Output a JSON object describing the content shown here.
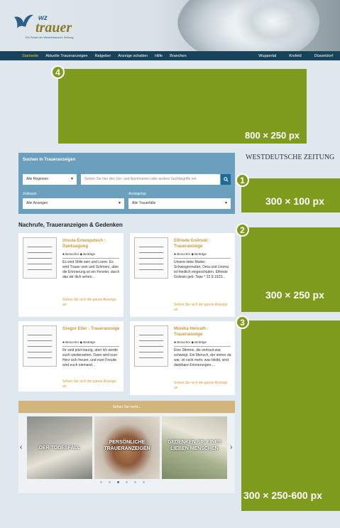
{
  "header": {
    "logo_wz": "wz",
    "logo_main": "trauer",
    "logo_tag": "Ein Portal der Westdeutschen Zeitung"
  },
  "nav": {
    "items": [
      "Startseite",
      "Aktuelle Traueranzeigen",
      "Ratgeber",
      "Anzeige schalten",
      "Hilfe",
      "Branchen"
    ],
    "right_items": [
      "Wuppertal",
      "Krefeld",
      "Düsseldorf"
    ]
  },
  "ads": {
    "leaderboard": {
      "badge": "4",
      "label": "800 × 250 px"
    },
    "ad1": {
      "badge": "1",
      "label": "300 × 100 px"
    },
    "ad2": {
      "badge": "2",
      "label": "300 × 250 px"
    },
    "ad3": {
      "badge": "3",
      "label": "300 × 250-600 px"
    }
  },
  "partner_logo": "Westdeutsche Zeitung",
  "search": {
    "title": "Suchen in Traueranzeigen",
    "region": "Alle Regionen",
    "query_placeholder": "Geben Sie hier den Vor- und Nachnamen oder andere Suchbegriffe ein",
    "timeframe_label": "Zeitraum",
    "timeframe_value": "Alle Anzeigen",
    "type_label": "Anzeigetyp",
    "type_value": "Alle Trauerfälle"
  },
  "section_title": "Nachrufe, Traueranzeigen & Gedenken",
  "cards": [
    {
      "name": "Ursula Ernenputsch : Danksagung",
      "visitors": "Besucher",
      "posts": "Beiträge",
      "text": "Es wird Stille sein und Leere. Es wird Trauer sein und Schmerz, aber die Erinnerung ist ein Fenster, durch das wir dich sehen...",
      "more": "Sehen Sie sich die ganze Anzeige an"
    },
    {
      "name": "Elfriede Golinski : Traueranzeige",
      "visitors": "Besucher",
      "posts": "Beiträge",
      "text": "Unsere liebe Mutter, Schwiegermutter, Oma und Uroma ist friedlich eingeschlafen. Elfriede Golinski geb. Tepe * 22.9.1923...",
      "more": "Sehen Sie sich die ganze Anzeige an"
    },
    {
      "name": "Gregor Eller : Traueranzeige",
      "visitors": "Besucher",
      "posts": "Beiträge",
      "text": "Ihr seid jetzt traurig, aber ich werde euch wiedersehen. Dann wird euer Herz sich freuen, und eure Freude wird euch niemand...",
      "more": "Sehen Sie sich die ganze Anzeige an"
    },
    {
      "name": "Monika Horvath : Traueranzeige",
      "visitors": "Besucher",
      "posts": "Beiträge",
      "text": "Eine Stimme, die vertraut war, schweigt. Ein Mensch, der immer da war, ist nicht mehr. was bleibt, sind dankbare Erinnerungen,...",
      "more": "Sehen Sie sich die ganze Anzeige an"
    }
  ],
  "show_more": "Sehen Sie mehr...",
  "carousel": {
    "tiles": [
      "DER TODESFALL",
      "PERSÖNLICHE TRAUERANZEIGEN",
      "GEDENKEN SIE EINES LIEBEN MENSCHEN"
    ],
    "prev": "‹",
    "next": "›"
  },
  "colors": {
    "nav": "#17425a",
    "nav_active": "#f2c23a",
    "ad": "#7f9b1e",
    "search_panel": "#6a9fbd",
    "accent_gold": "#c49a3a"
  }
}
